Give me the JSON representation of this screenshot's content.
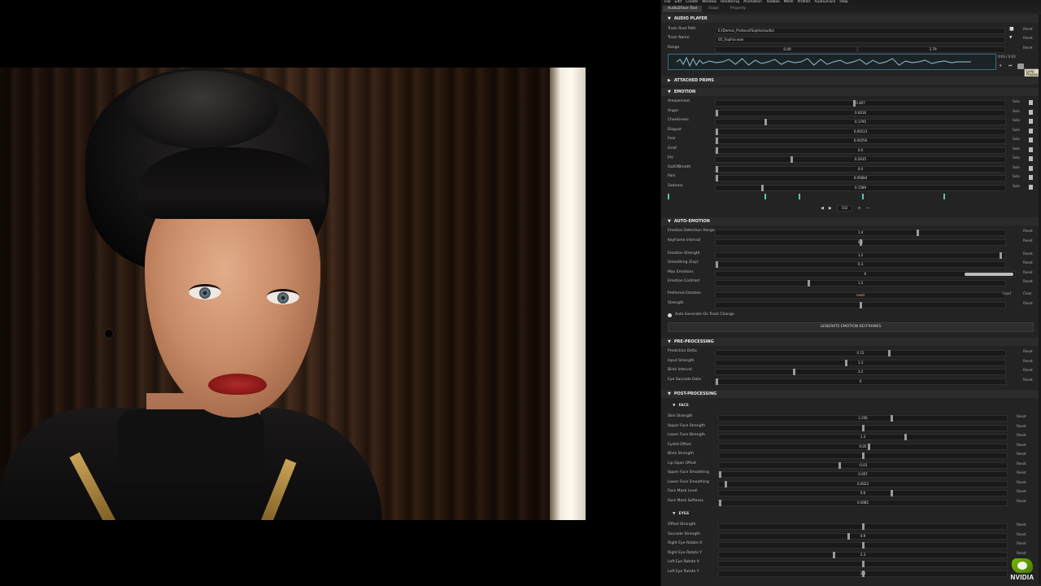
{
  "menubar": {
    "items": [
      "File",
      "Edit",
      "Create",
      "Window",
      "Rendering",
      "Animation",
      "Toolbox",
      "Mesh",
      "Profiler",
      "Audio2Face",
      "Help"
    ]
  },
  "tabs": [
    {
      "label": "Audio2Face Tool",
      "active": true
    },
    {
      "label": "Stage",
      "active": false
    },
    {
      "label": "Property",
      "active": false
    }
  ],
  "audio_player": {
    "title": "AUDIO PLAYER",
    "track_root_label": "Track Root Path",
    "track_root_value": "E:/Demos_Protocol/Sophia/audio/",
    "track_name_label": "Track Name",
    "track_name_value": "05_Sophia.wav",
    "range_label": "Range",
    "range_start": "0.00",
    "range_end": "3.79",
    "time_readout": "0:03 / 0:03",
    "reset": "Reset",
    "tooltip": "Loop Playback"
  },
  "attached_prims": {
    "title": "ATTACHED PRIMS"
  },
  "emotion": {
    "title": "EMOTION",
    "rows": [
      {
        "label": "Amazement",
        "value": "0.467",
        "pos": 0.48
      },
      {
        "label": "Anger",
        "value": "0.0016",
        "pos": 0.0
      },
      {
        "label": "Cheekiness",
        "value": "0.1795",
        "pos": 0.17
      },
      {
        "label": "Disgust",
        "value": "0.00113",
        "pos": 0.0
      },
      {
        "label": "Fear",
        "value": "0.00256",
        "pos": 0.0
      },
      {
        "label": "Grief",
        "value": "0.0",
        "pos": 0.0
      },
      {
        "label": "Joy",
        "value": "0.2635",
        "pos": 0.26
      },
      {
        "label": "OutOfBreath",
        "value": "0.0",
        "pos": 0.0
      },
      {
        "label": "Pain",
        "value": "0.00084",
        "pos": 0.0
      },
      {
        "label": "Sadness",
        "value": "0.1589",
        "pos": 0.16
      }
    ],
    "solo": "Solo",
    "frame": "102"
  },
  "auto_emotion": {
    "title": "AUTO-EMOTION",
    "rows": [
      {
        "label": "Emotion Detection Range",
        "value": "1.4",
        "pos": 0.7
      },
      {
        "label": "Keyframe Interval",
        "value": "0.2",
        "pos": 0.5
      },
      {
        "label": "Emotion Strength",
        "value": "1.2",
        "pos": 0.99
      },
      {
        "label": "Smoothing (Exp)",
        "value": "0.3",
        "pos": 0.0
      },
      {
        "label": "Max Emotions",
        "value": "6",
        "pos": 0.0
      },
      {
        "label": "Emotion Contrast",
        "value": "1.2",
        "pos": 0.32
      },
      {
        "label": "Preferred Emotion",
        "value": "reset",
        "pos": 0.0
      },
      {
        "label": "Strength",
        "value": "",
        "pos": 0.5
      }
    ],
    "reset": "Reset",
    "load": "Load",
    "clear": "Clear",
    "auto_generate_label": "Auto Generate On Track Change",
    "generate_button": "GENERATE EMOTION KEYFRAMES"
  },
  "pre_processing": {
    "title": "PRE-PROCESSING",
    "rows": [
      {
        "label": "Prediction Delta",
        "value": "0.15",
        "pos": 0.6
      },
      {
        "label": "Input Strength",
        "value": "1.3",
        "pos": 0.45
      },
      {
        "label": "Blink Interval",
        "value": "3.2",
        "pos": 0.27
      },
      {
        "label": "Eye Saccade Data",
        "value": "0",
        "pos": 0.0
      }
    ]
  },
  "post_processing": {
    "title": "POST-PROCESSING",
    "face_title": "FACE",
    "face_rows": [
      {
        "label": "Skin Strength",
        "value": "1.256",
        "pos": 0.6
      },
      {
        "label": "Upper Face Strength",
        "value": "",
        "pos": 0.5
      },
      {
        "label": "Lower Face Strength",
        "value": "1.3",
        "pos": 0.65
      },
      {
        "label": "Eyelid Offset",
        "value": "0.05",
        "pos": 0.52
      },
      {
        "label": "Blink Strength",
        "value": "",
        "pos": 0.5
      },
      {
        "label": "Lip Open Offset",
        "value": "-0.03",
        "pos": 0.42
      },
      {
        "label": "Upper Face Smoothing",
        "value": "0.007",
        "pos": 0.0
      },
      {
        "label": "Lower Face Smoothing",
        "value": "0.0023",
        "pos": 0.02
      },
      {
        "label": "Face Mask Level",
        "value": "0.6",
        "pos": 0.6
      },
      {
        "label": "Face Mask Softness",
        "value": "0.0085",
        "pos": 0.0
      }
    ],
    "eyes_title": "EYES",
    "eyes_rows": [
      {
        "label": "Offset Strength",
        "value": "",
        "pos": 0.5
      },
      {
        "label": "Saccade Strength",
        "value": "0.9",
        "pos": 0.45
      },
      {
        "label": "Right Eye Rotate X",
        "value": "",
        "pos": 0.5
      },
      {
        "label": "Right Eye Rotate Y",
        "value": "2.3",
        "pos": 0.4
      },
      {
        "label": "Left Eye Rotate X",
        "value": "",
        "pos": 0.5
      },
      {
        "label": "Left Eye Rotate Y",
        "value": "2.3",
        "pos": 0.5
      }
    ],
    "reset": "Reset"
  },
  "brand": {
    "name": "NVIDIA",
    "color": "#76b900"
  }
}
